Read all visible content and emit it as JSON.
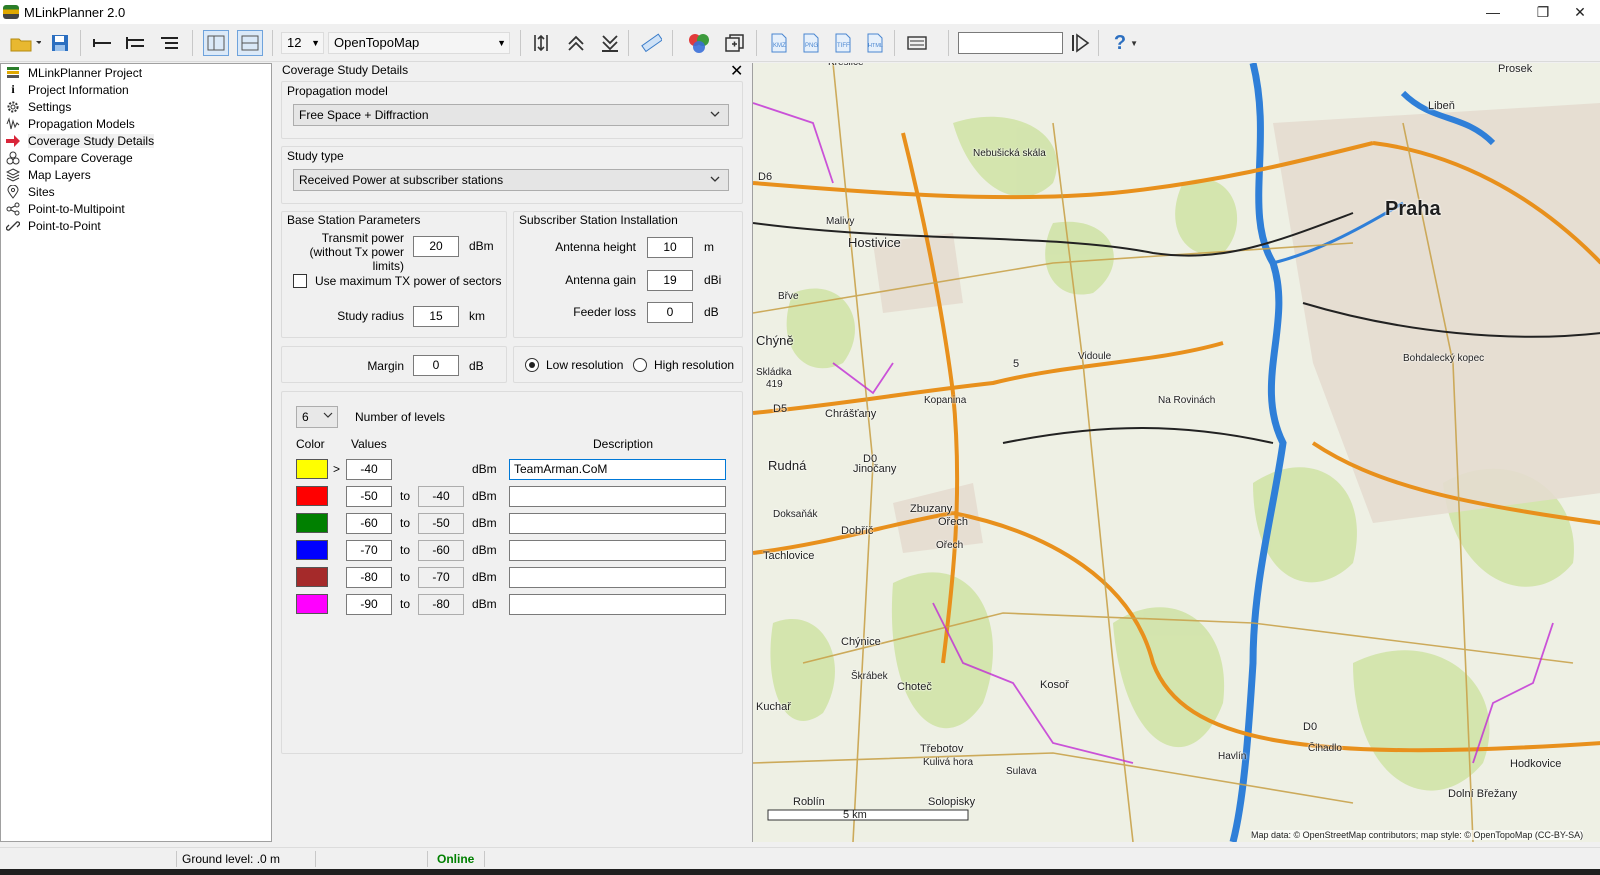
{
  "window": {
    "title": "MLinkPlanner 2.0",
    "controls": {
      "minimize": "—",
      "maximize": "❐",
      "close": "✕"
    }
  },
  "toolbar": {
    "zoom_level": "12",
    "map_source": "OpenTopoMap",
    "search_value": "",
    "help_label": "?"
  },
  "tree": {
    "items": [
      {
        "label": "MLinkPlanner Project",
        "icon": "project-icon"
      },
      {
        "label": "Project Information",
        "icon": "info-icon"
      },
      {
        "label": "Settings",
        "icon": "gear-icon"
      },
      {
        "label": "Propagation Models",
        "icon": "wave-icon"
      },
      {
        "label": "Coverage Study Details",
        "icon": "arrow-right-icon",
        "selected": true
      },
      {
        "label": "Compare Coverage",
        "icon": "compare-icon"
      },
      {
        "label": "Map Layers",
        "icon": "layers-icon"
      },
      {
        "label": "Sites",
        "icon": "pin-icon"
      },
      {
        "label": "Point-to-Multipoint",
        "icon": "share-icon"
      },
      {
        "label": "Point-to-Point",
        "icon": "link-icon"
      }
    ]
  },
  "panel": {
    "title": "Coverage Study Details",
    "propagation": {
      "label": "Propagation model",
      "value": "Free Space + Diffraction"
    },
    "study_type": {
      "label": "Study type",
      "value": "Received Power at subscriber stations"
    },
    "base": {
      "label": "Base Station Parameters",
      "tx_label_1": "Transmit power",
      "tx_label_2": "(without Tx power limits)",
      "tx_value": "20",
      "tx_unit": "dBm",
      "use_max_label": "Use maximum TX power of sectors",
      "use_max_checked": false,
      "radius_label": "Study radius",
      "radius_value": "15",
      "radius_unit": "km"
    },
    "subscriber": {
      "label": "Subscriber Station Installation",
      "height_label": "Antenna height",
      "height_value": "10",
      "height_unit": "m",
      "gain_label": "Antenna gain",
      "gain_value": "19",
      "gain_unit": "dBi",
      "feeder_label": "Feeder loss",
      "feeder_value": "0",
      "feeder_unit": "dB"
    },
    "margin": {
      "label": "Margin",
      "value": "0",
      "unit": "dB"
    },
    "resolution": {
      "low": "Low resolution",
      "high": "High resolution",
      "selected": "low"
    },
    "levels": {
      "count": "6",
      "count_label": "Number of levels",
      "col_color": "Color",
      "col_values": "Values",
      "col_desc": "Description",
      "gt": ">",
      "to": "to",
      "unit": "dBm",
      "rows": [
        {
          "color": "#ffff00",
          "from": "-40",
          "to": "",
          "desc": "TeamArman.CoM"
        },
        {
          "color": "#ff0000",
          "from": "-50",
          "to": "-40",
          "desc": ""
        },
        {
          "color": "#008000",
          "from": "-60",
          "to": "-50",
          "desc": ""
        },
        {
          "color": "#0000ff",
          "from": "-70",
          "to": "-60",
          "desc": ""
        },
        {
          "color": "#a52a2a",
          "from": "-80",
          "to": "-70",
          "desc": ""
        },
        {
          "color": "#ff00ff",
          "from": "-90",
          "to": "-80",
          "desc": ""
        }
      ]
    }
  },
  "map": {
    "labels": {
      "praha": "Praha",
      "hostivice": "Hostivice",
      "chyne": "Chýně",
      "rudna": "Rudná",
      "jinocany": "Jinočany",
      "zbuzany": "Zbuzany",
      "chrastany": "Chrášťany",
      "dobric": "Dobříč",
      "tachlovice": "Tachlovice",
      "chynice": "Chýnice",
      "chotec": "Choteč",
      "kosor": "Kosoř",
      "trebotov": "Třebotov",
      "kuliva_hora": "Kulivá hora",
      "sulava": "Sulava",
      "roblin": "Roblín",
      "solopisky": "Solopisky",
      "kuchar": "Kuchař",
      "havlin": "Havlín",
      "cihadlo": "Čihadlo",
      "hodkovice": "Hodkovice",
      "dolni_brezany": "Dolní Břežany",
      "liben": "Libeň",
      "prosek": "Prosek",
      "bohdalecky": "Bohdalecký kopec",
      "na_rovinach": "Na Rovinách",
      "vidoule": "Vidoule",
      "kopanina": "Kopanina",
      "nebusicka": "Nebušická skála",
      "malivy": "Malivy",
      "brve": "Břve",
      "skladka": "Skládka",
      "skladka_num": "419",
      "doksanak": "Doksaňák",
      "orech": "Ořech",
      "orech2": "Ořech",
      "skrabek": "Škrábek",
      "d6": "D6",
      "d5": "D5",
      "d0": "D0",
      "d0b": "D0",
      "r5": "5",
      "kriezevos": "Křeslice"
    },
    "scale_label": "5 km",
    "attribution": "Map data: © OpenStreetMap contributors; map style: © OpenTopoMap (CC-BY-SA)"
  },
  "status": {
    "ground_level": "Ground level: .0 m",
    "online": "Online"
  },
  "colors": {
    "online": "#008000",
    "road_major": "#e8901c",
    "water": "#2f7fd8",
    "forest": "#cfe3a5"
  }
}
